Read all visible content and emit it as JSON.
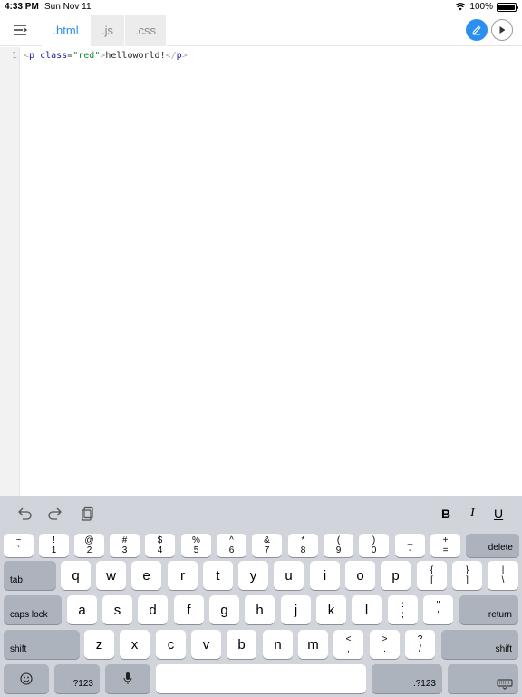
{
  "status_bar": {
    "time": "4:33 PM",
    "date": "Sun Nov 11",
    "battery": "100%"
  },
  "toolbar": {
    "tabs": [
      {
        "label": ".html",
        "active": true
      },
      {
        "label": ".js",
        "active": false
      },
      {
        "label": ".css",
        "active": false
      }
    ],
    "accent_color": "#2c8ff0"
  },
  "editor": {
    "line_number": "1",
    "code_tokens": {
      "open_bracket": "<",
      "tag": "p",
      "attr": "class",
      "eq": "=",
      "value": "\"red\"",
      "close_bracket": ">",
      "text": "helloworld!",
      "end_tag_open": "</",
      "end_tag": "p",
      "end_bracket": ">"
    }
  },
  "keyboard": {
    "format_buttons": {
      "bold": "B",
      "italic": "I",
      "underline": "U"
    },
    "number_row": [
      {
        "top": "~",
        "bottom": "`"
      },
      {
        "top": "!",
        "bottom": "1"
      },
      {
        "top": "@",
        "bottom": "2"
      },
      {
        "top": "#",
        "bottom": "3"
      },
      {
        "top": "$",
        "bottom": "4"
      },
      {
        "top": "%",
        "bottom": "5"
      },
      {
        "top": "^",
        "bottom": "6"
      },
      {
        "top": "&",
        "bottom": "7"
      },
      {
        "top": "*",
        "bottom": "8"
      },
      {
        "top": "(",
        "bottom": "9"
      },
      {
        "top": ")",
        "bottom": "0"
      },
      {
        "top": "_",
        "bottom": "-"
      },
      {
        "top": "+",
        "bottom": "="
      }
    ],
    "delete": "delete",
    "tab": "tab",
    "row_q": [
      "q",
      "w",
      "e",
      "r",
      "t",
      "y",
      "u",
      "i",
      "o",
      "p"
    ],
    "row_q_extra": [
      {
        "top": "{",
        "bottom": "["
      },
      {
        "top": "}",
        "bottom": "]"
      },
      {
        "top": "|",
        "bottom": "\\"
      }
    ],
    "caps_lock": "caps lock",
    "row_a": [
      "a",
      "s",
      "d",
      "f",
      "g",
      "h",
      "j",
      "k",
      "l"
    ],
    "row_a_extra": [
      {
        "top": ":",
        "bottom": ";"
      },
      {
        "top": "\"",
        "bottom": "'"
      }
    ],
    "return": "return",
    "shift": "shift",
    "row_z": [
      "z",
      "x",
      "c",
      "v",
      "b",
      "n",
      "m"
    ],
    "row_z_extra": [
      {
        "top": "<",
        "bottom": ","
      },
      {
        "top": ">",
        "bottom": "."
      },
      {
        "top": "?",
        "bottom": "/"
      }
    ],
    "numbers_key": ".?123",
    "icons": [
      "undo-icon",
      "redo-icon",
      "paste-icon",
      "emoji-icon",
      "microphone-icon",
      "keyboard-dismiss-icon"
    ]
  }
}
